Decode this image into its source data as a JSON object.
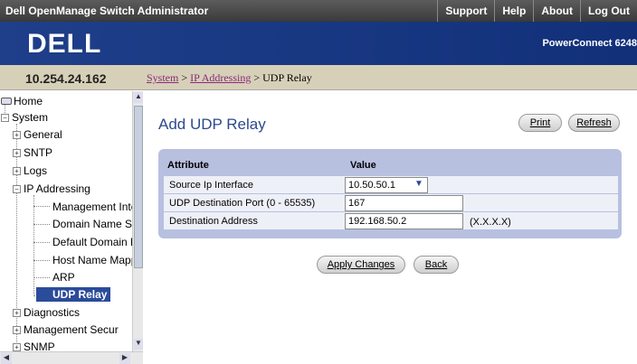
{
  "topbar": {
    "title": "Dell OpenManage Switch Administrator",
    "links": [
      "Support",
      "Help",
      "About",
      "Log Out"
    ]
  },
  "banner": {
    "logo": "DELL",
    "product": "PowerConnect 6248"
  },
  "ip_address": "10.254.24.162",
  "breadcrumb": {
    "items": [
      "System",
      "IP Addressing",
      "UDP Relay"
    ],
    "separator": ">"
  },
  "nav": {
    "items": [
      {
        "label": "Home"
      },
      {
        "label": "System"
      },
      {
        "label": "General"
      },
      {
        "label": "SNTP"
      },
      {
        "label": "Logs"
      },
      {
        "label": "IP Addressing"
      },
      {
        "label": "Management Inte"
      },
      {
        "label": "Domain Name S"
      },
      {
        "label": "Default Domain N"
      },
      {
        "label": "Host Name Mapp"
      },
      {
        "label": "ARP"
      },
      {
        "label": "UDP Relay"
      },
      {
        "label": "Diagnostics"
      },
      {
        "label": "Management Secur"
      },
      {
        "label": "SNMP"
      }
    ],
    "selected": "UDP Relay"
  },
  "page": {
    "title": "Add UDP Relay",
    "print_label": "Print",
    "refresh_label": "Refresh",
    "table": {
      "headers": [
        "Attribute",
        "Value"
      ],
      "rows": [
        {
          "label": "Source Ip Interface",
          "value": "10.50.50.1",
          "hint": ""
        },
        {
          "label": "UDP Destination Port (0 - 65535)",
          "value": "167",
          "hint": ""
        },
        {
          "label": "Destination Address",
          "value": "192.168.50.2",
          "hint": "(X.X.X.X)"
        }
      ]
    },
    "apply_label": "Apply Changes",
    "back_label": "Back"
  },
  "colors": {
    "banner": "#1f3f8a",
    "title": "#2b4a8c",
    "panel": "#b8c0e0",
    "selected_nav": "#2b4b9b",
    "link": "#8a2a7a"
  }
}
